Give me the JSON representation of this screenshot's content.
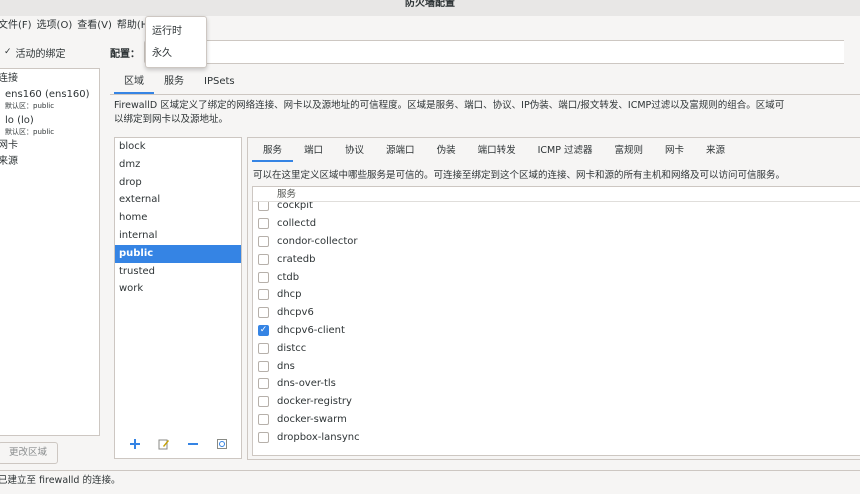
{
  "window": {
    "title": "防火墙配置"
  },
  "menubar": {
    "items": [
      "文件(F)",
      "选项(O)",
      "查看(V)",
      "帮助(H)"
    ]
  },
  "popup_menu": {
    "items": [
      "运行时",
      "永久"
    ]
  },
  "left": {
    "header": "活动的绑定",
    "section_connections": "连接",
    "connections": [
      {
        "name": "ens160 (ens160)",
        "zone": "默认区：public"
      },
      {
        "name": "lo (lo)",
        "zone": "默认区：public"
      }
    ],
    "section_interfaces": "网卡",
    "section_sources": "来源",
    "change_zone_button": "更改区域"
  },
  "config": {
    "label": "配置：",
    "value": ""
  },
  "main_tabs": [
    "区域",
    "服务",
    "IPSets"
  ],
  "main_tab_active": 0,
  "zone_description": [
    "FirewallD 区域定义了绑定的网络连接、网卡以及源地址的可信程度。区域是服务、端口、协议、IP伪装、端口/报文转发、ICMP过滤以及富规则的组合。区域可",
    "以绑定到网卡以及源地址。"
  ],
  "zones": [
    "block",
    "dmz",
    "drop",
    "external",
    "home",
    "internal",
    "public",
    "trusted",
    "work"
  ],
  "zone_selected": "public",
  "sub_tabs": [
    "服务",
    "端口",
    "协议",
    "源端口",
    "伪装",
    "端口转发",
    "ICMP 过滤器",
    "富规则",
    "网卡",
    "来源"
  ],
  "sub_tab_active": 0,
  "services_description": "可以在这里定义区域中哪些服务是可信的。可连接至绑定到这个区域的连接、网卡和源的所有主机和网络及可以访问可信服务。",
  "services_header": "服务",
  "services": [
    {
      "name": "cockpit",
      "checked": false
    },
    {
      "name": "collectd",
      "checked": false
    },
    {
      "name": "condor-collector",
      "checked": false
    },
    {
      "name": "cratedb",
      "checked": false
    },
    {
      "name": "ctdb",
      "checked": false
    },
    {
      "name": "dhcp",
      "checked": false
    },
    {
      "name": "dhcpv6",
      "checked": false
    },
    {
      "name": "dhcpv6-client",
      "checked": true
    },
    {
      "name": "distcc",
      "checked": false
    },
    {
      "name": "dns",
      "checked": false
    },
    {
      "name": "dns-over-tls",
      "checked": false
    },
    {
      "name": "docker-registry",
      "checked": false
    },
    {
      "name": "docker-swarm",
      "checked": false
    },
    {
      "name": "dropbox-lansync",
      "checked": false
    }
  ],
  "status": {
    "text": "已建立至 firewalld 的连接。"
  },
  "colors": {
    "accent": "#3584e4",
    "border": "#cdc7c2",
    "background": "#f6f5f4"
  },
  "icons": {
    "add": "plus-icon",
    "edit": "edit-icon",
    "remove": "minus-icon",
    "load": "load-defaults-icon"
  }
}
